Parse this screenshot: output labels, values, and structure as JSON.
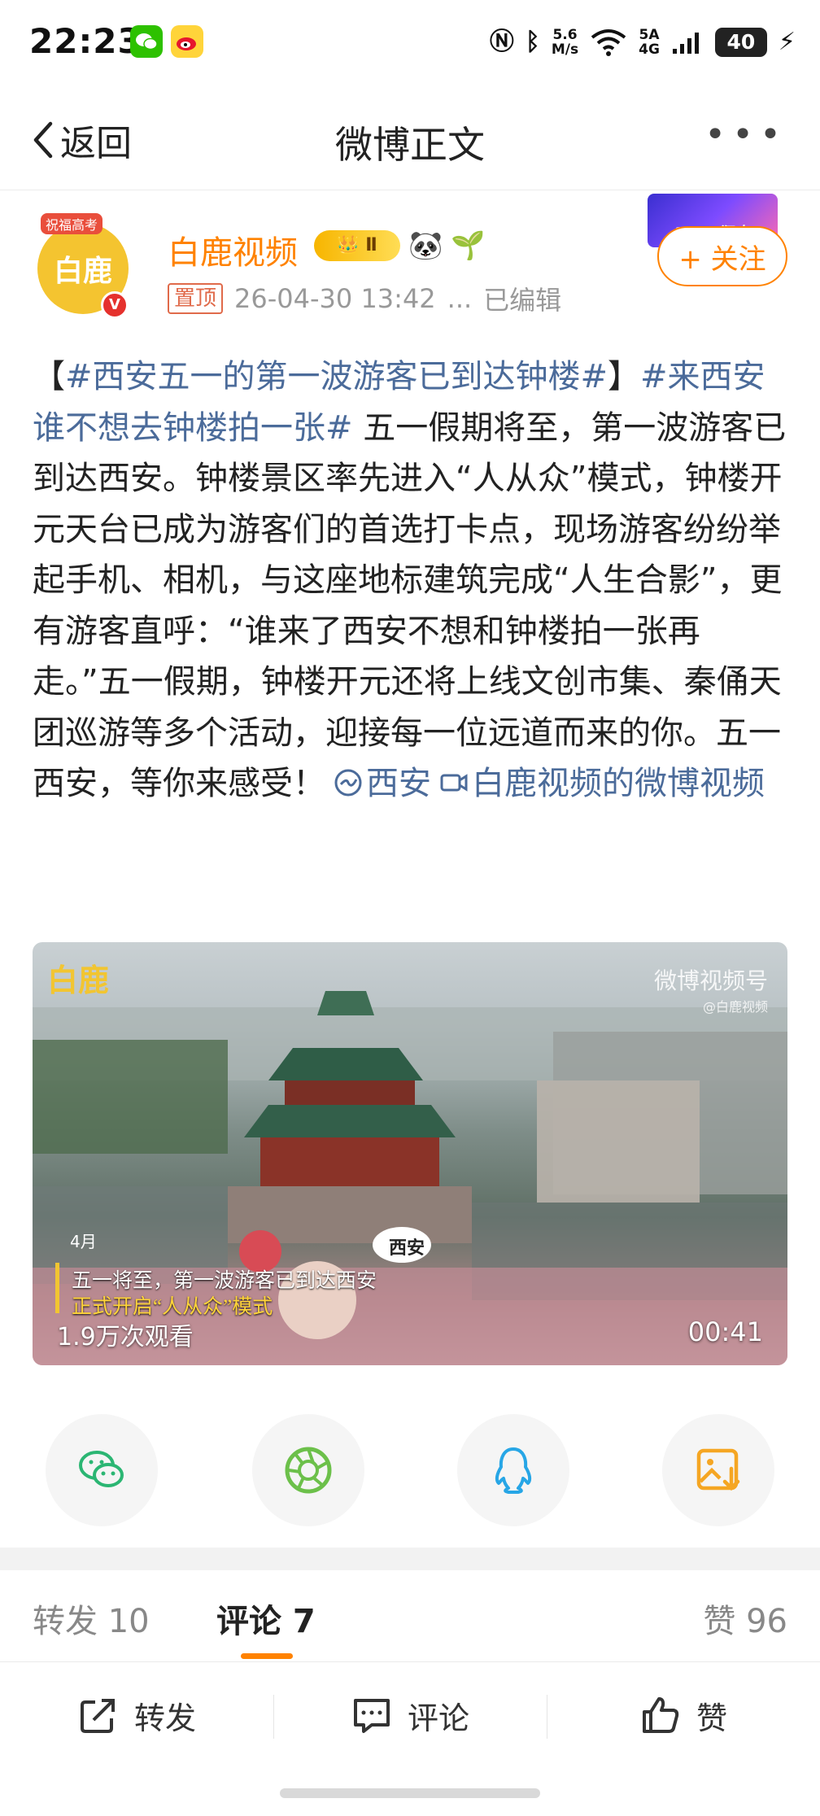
{
  "status_bar": {
    "time": "22:23",
    "network_speed_top": "5.6",
    "network_speed_bottom": "M/s",
    "signal_top": "5A",
    "signal_bottom": "4G",
    "battery": "40",
    "icons": [
      "wechat-icon",
      "weibo-icon",
      "nfc-icon",
      "bluetooth-icon",
      "wifi-icon",
      "signal-icon",
      "charging-icon"
    ]
  },
  "nav": {
    "back_label": "返回",
    "title": "微博正文",
    "more_label": "•••"
  },
  "author": {
    "name": "白鹿视频",
    "avatar_text": "白鹿",
    "avatar_ribbon": "祝福高考",
    "crown_badge": "Ⅱ",
    "emoji_1": "🐼",
    "emoji_2": "🌱",
    "pinned": "置顶",
    "timestamp": "26-04-30 13:42",
    "ellipsis": "...",
    "edited": "已编辑",
    "banner_text": "2022 狂欢",
    "follow_label": "+ 关注"
  },
  "post": {
    "bracket_open": "【",
    "topic_1": "#西安五一的第一波游客已到达钟楼#",
    "bracket_close": "】",
    "topic_2": "#来西安谁不想去钟楼拍一张#",
    "body": " 五一假期将至，第一波游客已到达西安。钟楼景区率先进入“人从众”模式，钟楼开元天台已成为游客们的首选打卡点，现场游客纷纷举起手机、相机，与这座地标建筑完成“人生合影”，更有游客直呼：“谁来了西安不想和钟楼拍一张再走。”五一假期，钟楼开元还将上线文创市集、秦俑天团巡游等多个活动，迎接每一位远道而来的你。五一西安，等你来感受！",
    "location": "西安",
    "video_link": "白鹿视频的微博视频"
  },
  "video": {
    "watermark_logo": "白鹿",
    "brand": "微博视频号",
    "handle": "@白鹿视频",
    "location_tag": "4月",
    "sign_text": "西安",
    "caption_line_1": "五一将至，第一波游客已到达西安",
    "caption_line_2": "正式开启“人从众”模式",
    "views": "1.9万次观看",
    "duration": "00:41"
  },
  "share": {
    "buttons": [
      "wechat-share",
      "moments-share",
      "qq-share",
      "save-image"
    ]
  },
  "tabs": {
    "repost": "转发 10",
    "comment": "评论 7",
    "like": "赞 96"
  },
  "actions": {
    "repost": "转发",
    "comment": "评论",
    "like": "赞"
  },
  "colors": {
    "accent": "#ff8200",
    "link": "#4b6b9a",
    "verified": "#e5312d"
  }
}
